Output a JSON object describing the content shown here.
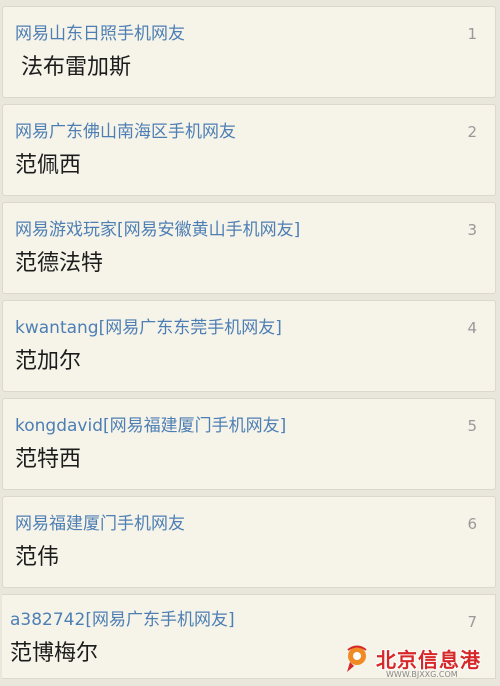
{
  "comments": [
    {
      "user": "网易山东日照手机网友",
      "text": "法布雷加斯",
      "floor": "1"
    },
    {
      "user": "网易广东佛山南海区手机网友",
      "text": "范佩西",
      "floor": "2"
    },
    {
      "user": "网易游戏玩家[网易安徽黄山手机网友]",
      "text": "范德法特",
      "floor": "3"
    },
    {
      "user": "kwantang[网易广东东莞手机网友]",
      "text": "范加尔",
      "floor": "4"
    },
    {
      "user": "kongdavid[网易福建厦门手机网友]",
      "text": "范特西",
      "floor": "5"
    },
    {
      "user": "网易福建厦门手机网友",
      "text": "范伟",
      "floor": "6"
    },
    {
      "user": "a382742[网易广东手机网友]",
      "text": "范博梅尔",
      "floor": "7"
    }
  ],
  "watermark": {
    "title": "北京信息港",
    "url": "WWW.BJXXG.COM",
    "icon": "bjxxg-logo-icon",
    "color": "#d62828"
  },
  "colors": {
    "username": "#4d7fb5",
    "background": "#e9e6db",
    "card": "#f6f3e8"
  }
}
